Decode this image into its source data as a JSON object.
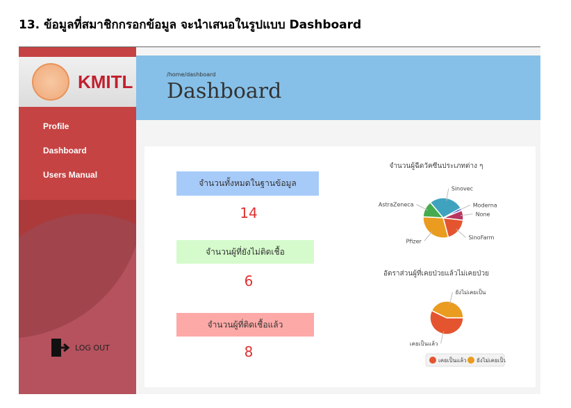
{
  "caption": "13. ข้อมูลที่สมาชิกกรอกข้อมูล จะนำเสนอในรูปแบบ Dashboard",
  "sidebar": {
    "logo_text": "KMITL",
    "items": [
      {
        "label": "Profile"
      },
      {
        "label": "Dashboard"
      },
      {
        "label": "Users Manual"
      }
    ],
    "logout": "LOG OUT"
  },
  "header": {
    "breadcrumb": "/home/dashboard",
    "title": "Dashboard"
  },
  "stats": [
    {
      "label": "จำนวนทั้งหมดในฐานข้อมูล",
      "value": "14",
      "color": "#a7cbf9"
    },
    {
      "label": "จำนวนผู้ที่ยังไม่ติดเชื้อ",
      "value": "6",
      "color": "#d5fbcc"
    },
    {
      "label": "จำนวนผู้ที่ติดเชื้อแล้ว",
      "value": "8",
      "color": "#fca9a7"
    }
  ],
  "chart_data": [
    {
      "type": "pie",
      "title": "จำนวนผู้ฉีดวัคซีนประเภทต่าง ๆ",
      "categories": [
        "Sinovec",
        "Moderna",
        "None",
        "SinoFarm",
        "Pfizer",
        "AstraZeneca"
      ],
      "values": [
        28,
        2,
        8,
        19,
        30,
        13
      ],
      "colors": [
        "#3fa3c0",
        "#3140c8",
        "#b8365f",
        "#e4552f",
        "#e99c1f",
        "#45ab4e"
      ]
    },
    {
      "type": "pie",
      "title": "อัตราส่วนผู้ที่เคยป่วยแล้วไม่เคยป่วย",
      "categories": [
        "เคยเป็นแล้ว",
        "ยังไม่เคยเป็น"
      ],
      "values": [
        8,
        6
      ],
      "colors": [
        "#e4552f",
        "#e99c1f"
      ],
      "legend": "bottom"
    }
  ]
}
